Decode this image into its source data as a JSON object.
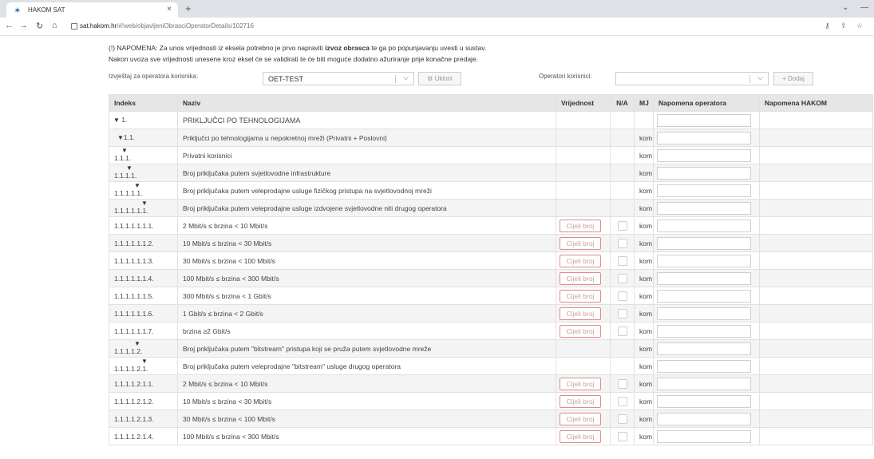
{
  "browser": {
    "tab_title": "HAKOM SAT",
    "tab_close": "×",
    "new_tab": "+",
    "url_host": "sat.hakom.hr",
    "url_path": "/#!web/objavljeniObrasciOperatorDetails/102716"
  },
  "notice": {
    "line1_before": "(!) NAPOMENA: Za unos vrijednosti iz eksela potrebno je prvo napraviti ",
    "line1_bold": "izvoz obrasca",
    "line1_after": " te ga po popunjavanju uvesti u sustav.",
    "line2": "Nakon uvoza sve vrijednosti unesene kroz eksel će se validirati te će biti moguće dodatno ažuriranje prije konačne predaje."
  },
  "filters": {
    "report_label": "Izvještaj za operatora korisnika:",
    "report_value": "OET-TEST",
    "remove_button": "Ukloni",
    "users_label": "Operatori korisnici:",
    "users_value": "",
    "add_button": "+ Dodaj"
  },
  "table": {
    "headers": {
      "index": "Indeks",
      "name": "Naziv",
      "value": "Vrijednost",
      "na": "N/A",
      "mj": "MJ",
      "op_note": "Napomena operatora",
      "hakom_note": "Napomena HAKOM"
    },
    "placeholder_int": "Cijeli broj",
    "rows": [
      {
        "index": "1.",
        "name": "PRIKLJUČCI PO TEHNOLOGIJAMA",
        "mj": ""
      },
      {
        "index": "1.1.",
        "name": "Priključci po tehnologijama u nepokretnoj mreži (Privatni + Poslovni)",
        "mj": "kom"
      },
      {
        "index": "1.1.1.",
        "name": "Privatni korisnici",
        "mj": "kom"
      },
      {
        "index": "1.1.1.1.",
        "name": "Broj priključaka putem svjetlovodne infrastrukture",
        "mj": "kom"
      },
      {
        "index": "1.1.1.1.1.",
        "name": "Broj priključaka putem veleprodajne usluge fizičkog pristupa na svjetlovodnoj mreži",
        "mj": "kom"
      },
      {
        "index": "1.1.1.1.1.1.",
        "name": "Broj priključaka putem veleprodajne usluge izdvojene svjetlovodne niti drugog operatora",
        "mj": "kom"
      },
      {
        "index": "1.1.1.1.1.1.1.",
        "name": "2 Mbit/s ≤ brzina < 10 Mbit/s",
        "mj": "kom"
      },
      {
        "index": "1.1.1.1.1.1.2.",
        "name": "10 Mbit/s ≤ brzina < 30 Mbit/s",
        "mj": "kom"
      },
      {
        "index": "1.1.1.1.1.1.3.",
        "name": "30 Mbit/s ≤ brzina < 100 Mbit/s",
        "mj": "kom"
      },
      {
        "index": "1.1.1.1.1.1.4.",
        "name": "100 Mbit/s ≤ brzina < 300 Mbit/s",
        "mj": "kom"
      },
      {
        "index": "1.1.1.1.1.1.5.",
        "name": "300 Mbit/s ≤ brzina < 1 Gbit/s",
        "mj": "kom"
      },
      {
        "index": "1.1.1.1.1.1.6.",
        "name": "1 Gbit/s ≤ brzina < 2 Gbit/s",
        "mj": "kom"
      },
      {
        "index": "1.1.1.1.1.1.7.",
        "name": "brzina ≥2 Gbit/s",
        "mj": "kom"
      },
      {
        "index": "1.1.1.1.2.",
        "name": "Broj priključaka putem \"bitstream\" pristupa koji se pruža putem svjetlovodne mreže",
        "mj": "kom"
      },
      {
        "index": "1.1.1.1.2.1.",
        "name": "Broj priključaka putem veleprodajne \"bitstream\" usluge drugog operatora",
        "mj": "kom"
      },
      {
        "index": "1.1.1.1.2.1.1.",
        "name": "2 Mbit/s ≤ brzina < 10 Mbit/s",
        "mj": "kom"
      },
      {
        "index": "1.1.1.1.2.1.2.",
        "name": "10 Mbit/s ≤ brzina < 30 Mbit/s",
        "mj": "kom"
      },
      {
        "index": "1.1.1.1.2.1.3.",
        "name": "30 Mbit/s ≤ brzina < 100 Mbit/s",
        "mj": "kom"
      },
      {
        "index": "1.1.1.1.2.1.4.",
        "name": "100 Mbit/s ≤ brzina < 300 Mbit/s",
        "mj": "kom"
      }
    ]
  }
}
